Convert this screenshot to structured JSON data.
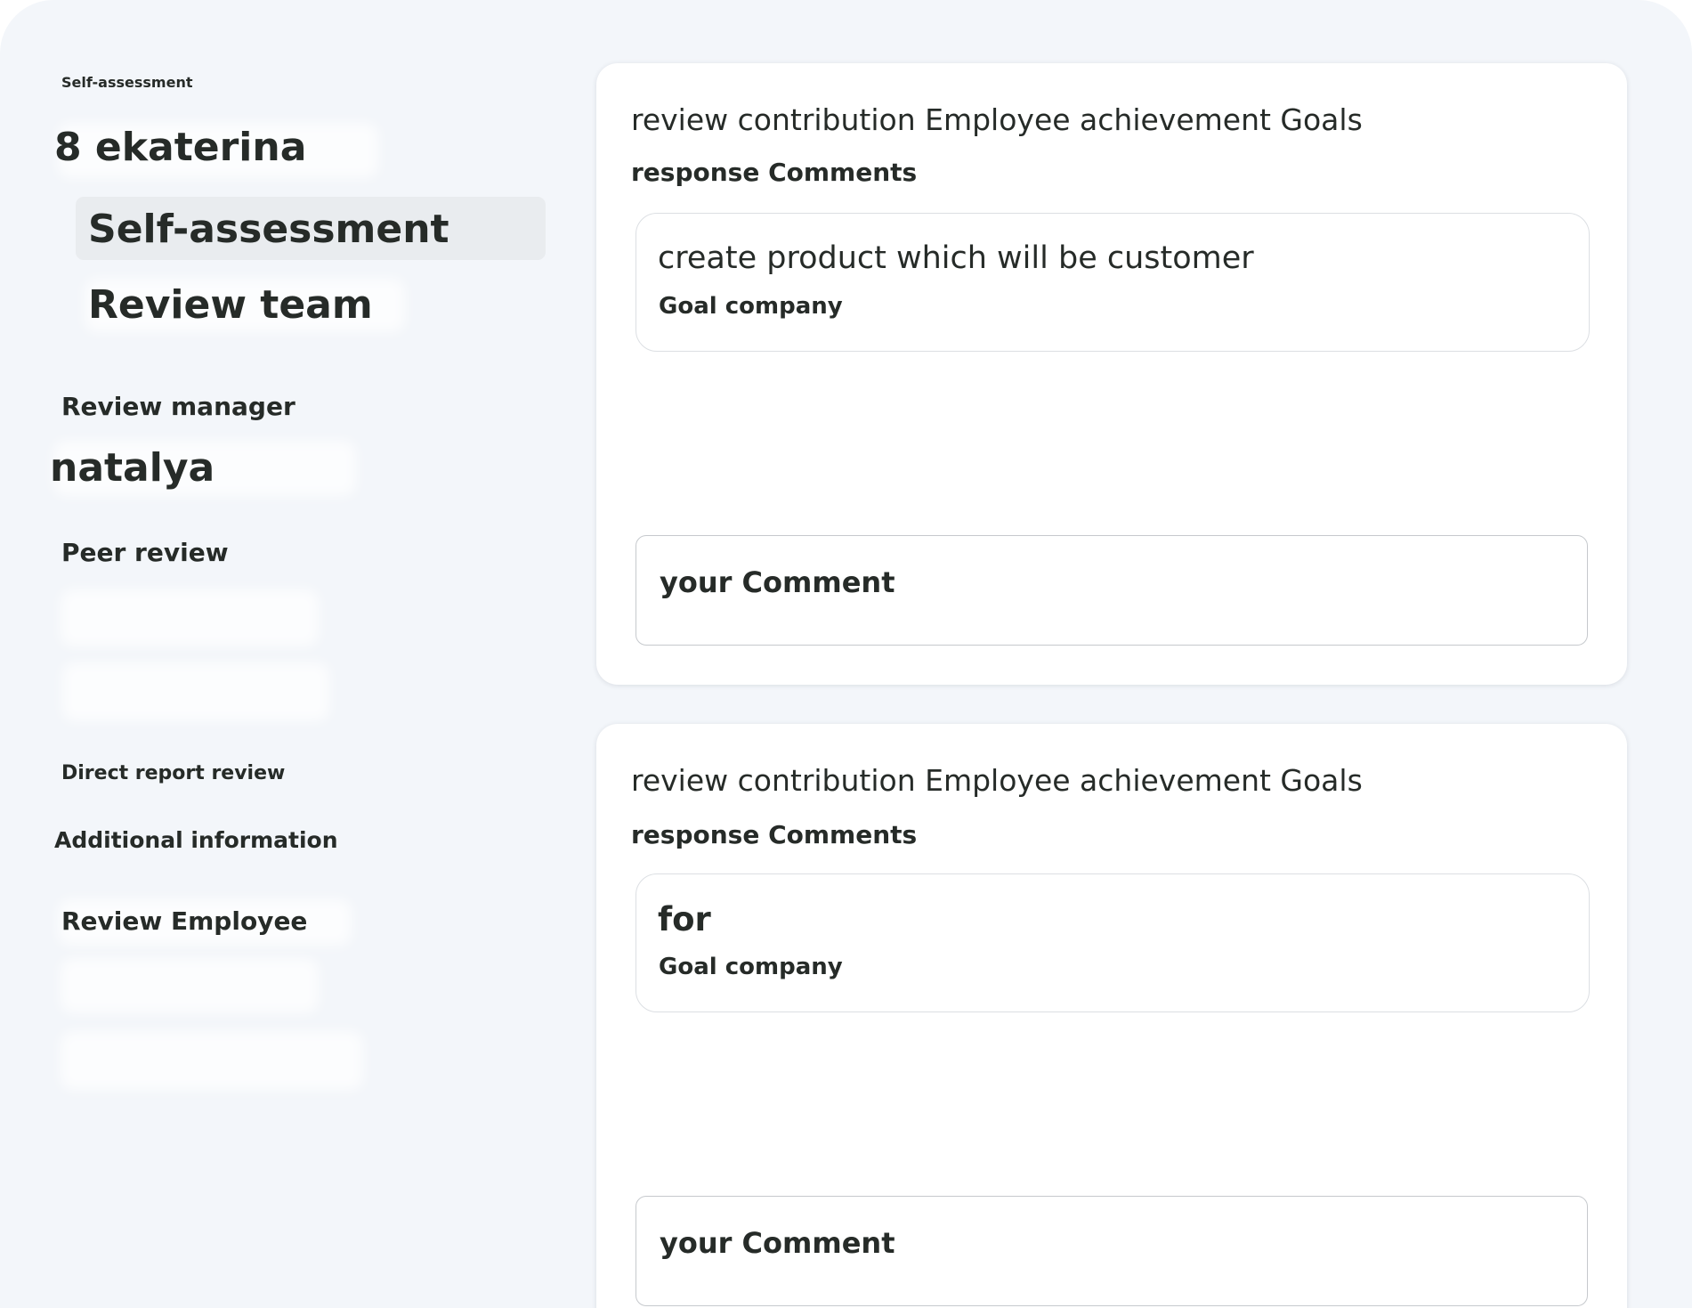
{
  "sidebar": {
    "section_label": "Self-assessment",
    "employee_name": "8 ekaterina",
    "nav_items": [
      {
        "label": "Self-assessment",
        "selected": true
      },
      {
        "label": "Review team",
        "selected": false
      }
    ],
    "review_manager_heading": "Review manager",
    "manager_name": "natalya",
    "peer_review_heading": "Peer review",
    "direct_report_heading": "Direct report review",
    "additional_info_heading": "Additional information",
    "review_employee_heading": "Review Employee"
  },
  "cards": [
    {
      "title": "review contribution Employee achievement Goals",
      "subtitle": "response Comments",
      "goal_text": "create product which will be customer",
      "goal_label": "Goal company",
      "comment_placeholder": "your Comment"
    },
    {
      "title": "review contribution Employee achievement Goals",
      "subtitle": "response Comments",
      "goal_text": "for",
      "goal_label": "Goal company",
      "comment_placeholder": "your Comment"
    }
  ],
  "colors": {
    "background": "#f3f6fa",
    "card": "#ffffff",
    "text": "#262b28",
    "selected_nav": "#e9ecef",
    "border": "#dcdfe3"
  }
}
